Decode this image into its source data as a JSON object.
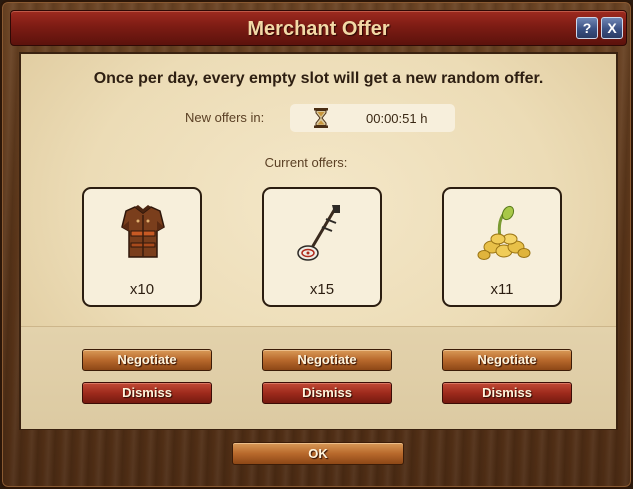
{
  "dialog": {
    "title": "Merchant Offer",
    "help_label": "?",
    "close_label": "X"
  },
  "info": {
    "headline": "Once per day, every empty slot will get a new random offer.",
    "timer_label": "New offers in:",
    "timer_value": "00:00:51 h",
    "offers_label": "Current offers:"
  },
  "offers": [
    {
      "icon": "armor-icon",
      "quantity": "x10",
      "negotiate_label": "Negotiate",
      "dismiss_label": "Dismiss"
    },
    {
      "icon": "banjo-icon",
      "quantity": "x15",
      "negotiate_label": "Negotiate",
      "dismiss_label": "Dismiss"
    },
    {
      "icon": "gold-seeds-icon",
      "quantity": "x11",
      "negotiate_label": "Negotiate",
      "dismiss_label": "Dismiss"
    }
  ],
  "footer": {
    "ok_label": "OK"
  },
  "colors": {
    "title_bar": "#7d1c14",
    "negotiate_button": "#b8692c",
    "dismiss_button": "#9e2a1c",
    "panel_background": "#ecdcb6"
  }
}
